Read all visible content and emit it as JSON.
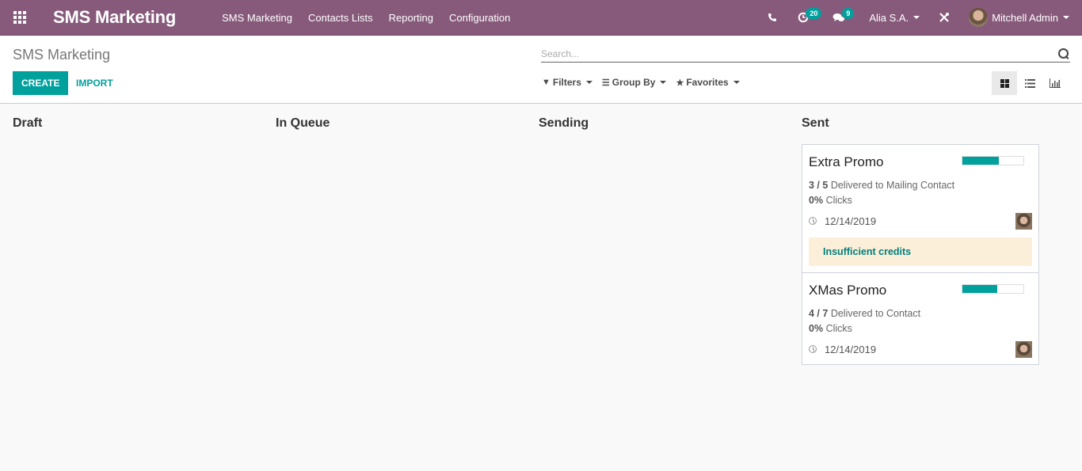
{
  "navbar": {
    "app_title": "SMS Marketing",
    "menu": [
      "SMS Marketing",
      "Contacts Lists",
      "Reporting",
      "Configuration"
    ],
    "activity_count": "20",
    "messages_count": "9",
    "company": "Alia S.A.",
    "user": "Mitchell Admin",
    "colors": {
      "brand": "#875a7b",
      "accent": "#00a09d"
    }
  },
  "control_panel": {
    "breadcrumb": "SMS Marketing",
    "create_label": "CREATE",
    "import_label": "IMPORT",
    "search_placeholder": "Search...",
    "filters_label": "Filters",
    "group_by_label": "Group By",
    "favorites_label": "Favorites",
    "views": [
      "kanban",
      "list",
      "graph"
    ],
    "active_view": "kanban"
  },
  "kanban": {
    "columns": [
      {
        "title": "Draft",
        "cards": []
      },
      {
        "title": "In Queue",
        "cards": []
      },
      {
        "title": "Sending",
        "cards": []
      },
      {
        "title": "Sent",
        "cards": [
          {
            "name": "Extra Promo",
            "delivered": "3 / 5",
            "delivered_text": "Delivered to Mailing Contact",
            "clicks": "0%",
            "clicks_text": "Clicks",
            "date": "12/14/2019",
            "progress_percent": 60,
            "alert": "Insufficient credits"
          },
          {
            "name": "XMas Promo",
            "delivered": "4 / 7",
            "delivered_text": "Delivered to Contact",
            "clicks": "0%",
            "clicks_text": "Clicks",
            "date": "12/14/2019",
            "progress_percent": 57
          }
        ]
      }
    ]
  }
}
